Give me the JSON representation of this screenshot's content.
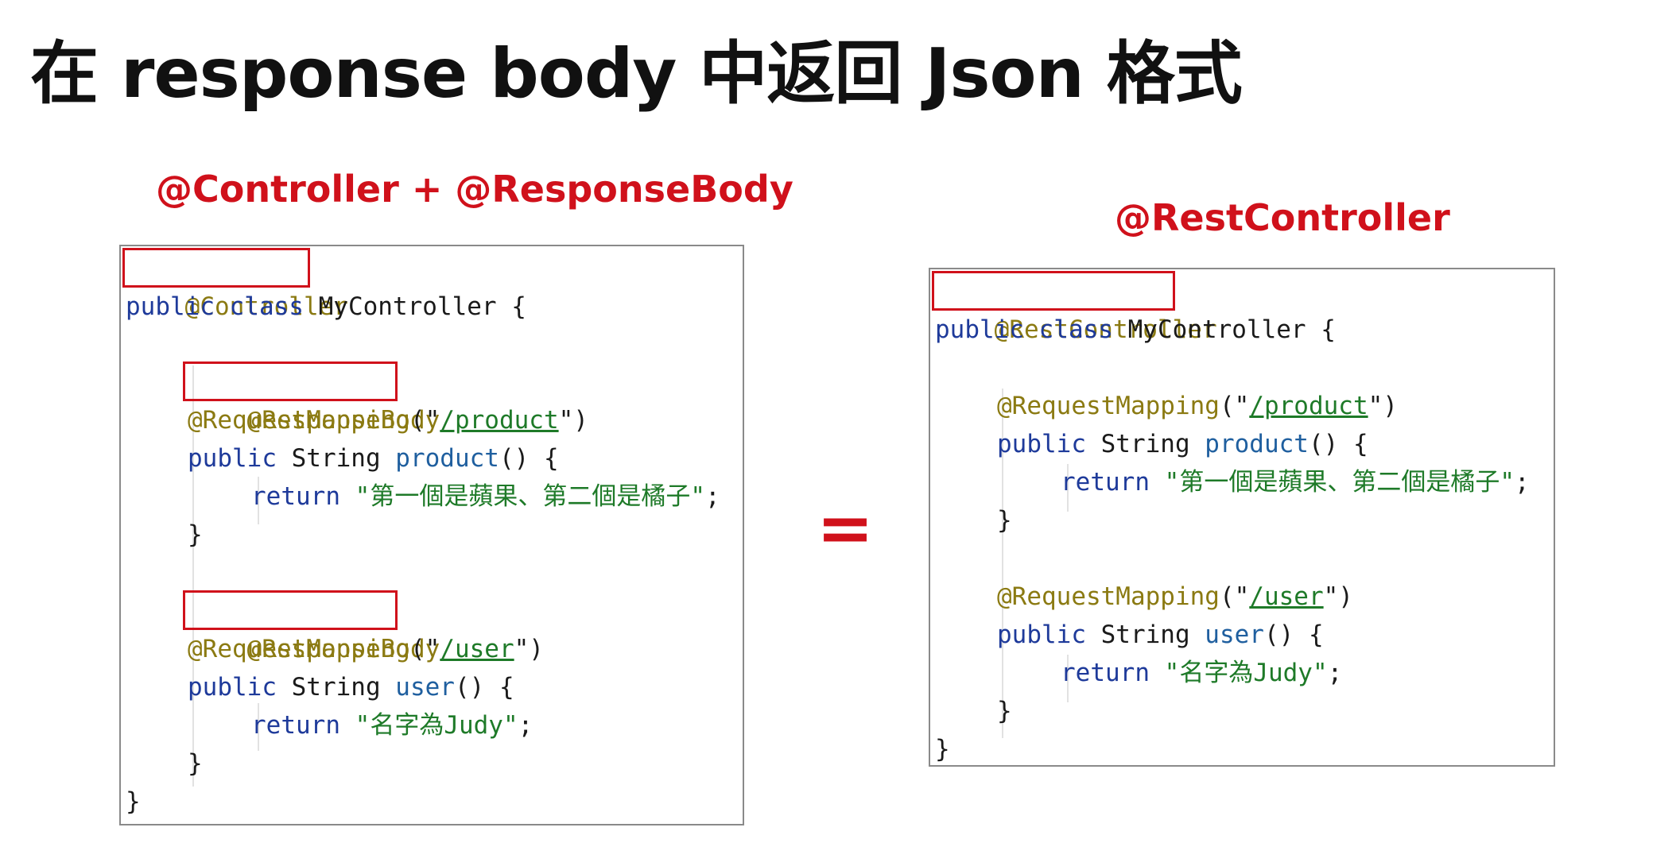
{
  "title": "在 response body 中返回 Json 格式",
  "left": {
    "heading": "@Controller + @ResponseBody",
    "lines": {
      "l1": "@Controller",
      "l2_kw": "public class",
      "l2_rest": " MyController {",
      "l4": "@ResponseBody",
      "l5_ann": "@RequestMapping",
      "l5_open": "(\"",
      "l5_url": "/product",
      "l5_close": "\")",
      "l6_kw": "public",
      "l6_type": " String ",
      "l6_meth": "product",
      "l6_rest": "() {",
      "l7_kw": "return",
      "l7_str": "\"第一個是蘋果、第二個是橘子\"",
      "l7_semi": ";",
      "l8": "}",
      "l10": "@ResponseBody",
      "l11_ann": "@RequestMapping",
      "l11_open": "(\"",
      "l11_url": "/user",
      "l11_close": "\")",
      "l12_kw": "public",
      "l12_type": " String ",
      "l12_meth": "user",
      "l12_rest": "() {",
      "l13_kw": "return",
      "l13_str": "\"名字為Judy\"",
      "l13_semi": ";",
      "l14": "}",
      "l15": "}"
    }
  },
  "equals_sign": "=",
  "right": {
    "heading": "@RestController",
    "lines": {
      "l1": "@RestController",
      "l2_kw": "public class",
      "l2_rest": " MyController {",
      "l4_ann": "@RequestMapping",
      "l4_open": "(\"",
      "l4_url": "/product",
      "l4_close": "\")",
      "l5_kw": "public",
      "l5_type": " String ",
      "l5_meth": "product",
      "l5_rest": "() {",
      "l6_kw": "return",
      "l6_str": "\"第一個是蘋果、第二個是橘子\"",
      "l6_semi": ";",
      "l7": "}",
      "l9_ann": "@RequestMapping",
      "l9_open": "(\"",
      "l9_url": "/user",
      "l9_close": "\")",
      "l10_kw": "public",
      "l10_type": " String ",
      "l10_meth": "user",
      "l10_rest": "() {",
      "l11_kw": "return",
      "l11_str": "\"名字為Judy\"",
      "l11_semi": ";",
      "l12": "}",
      "l13": "}"
    }
  },
  "colors": {
    "heading": "#d0111b",
    "annotation": "#8b7a12",
    "keyword": "#1e3a9a",
    "method": "#1f5f9f",
    "string": "#1e7a28",
    "highlight_box": "#d0111b"
  }
}
